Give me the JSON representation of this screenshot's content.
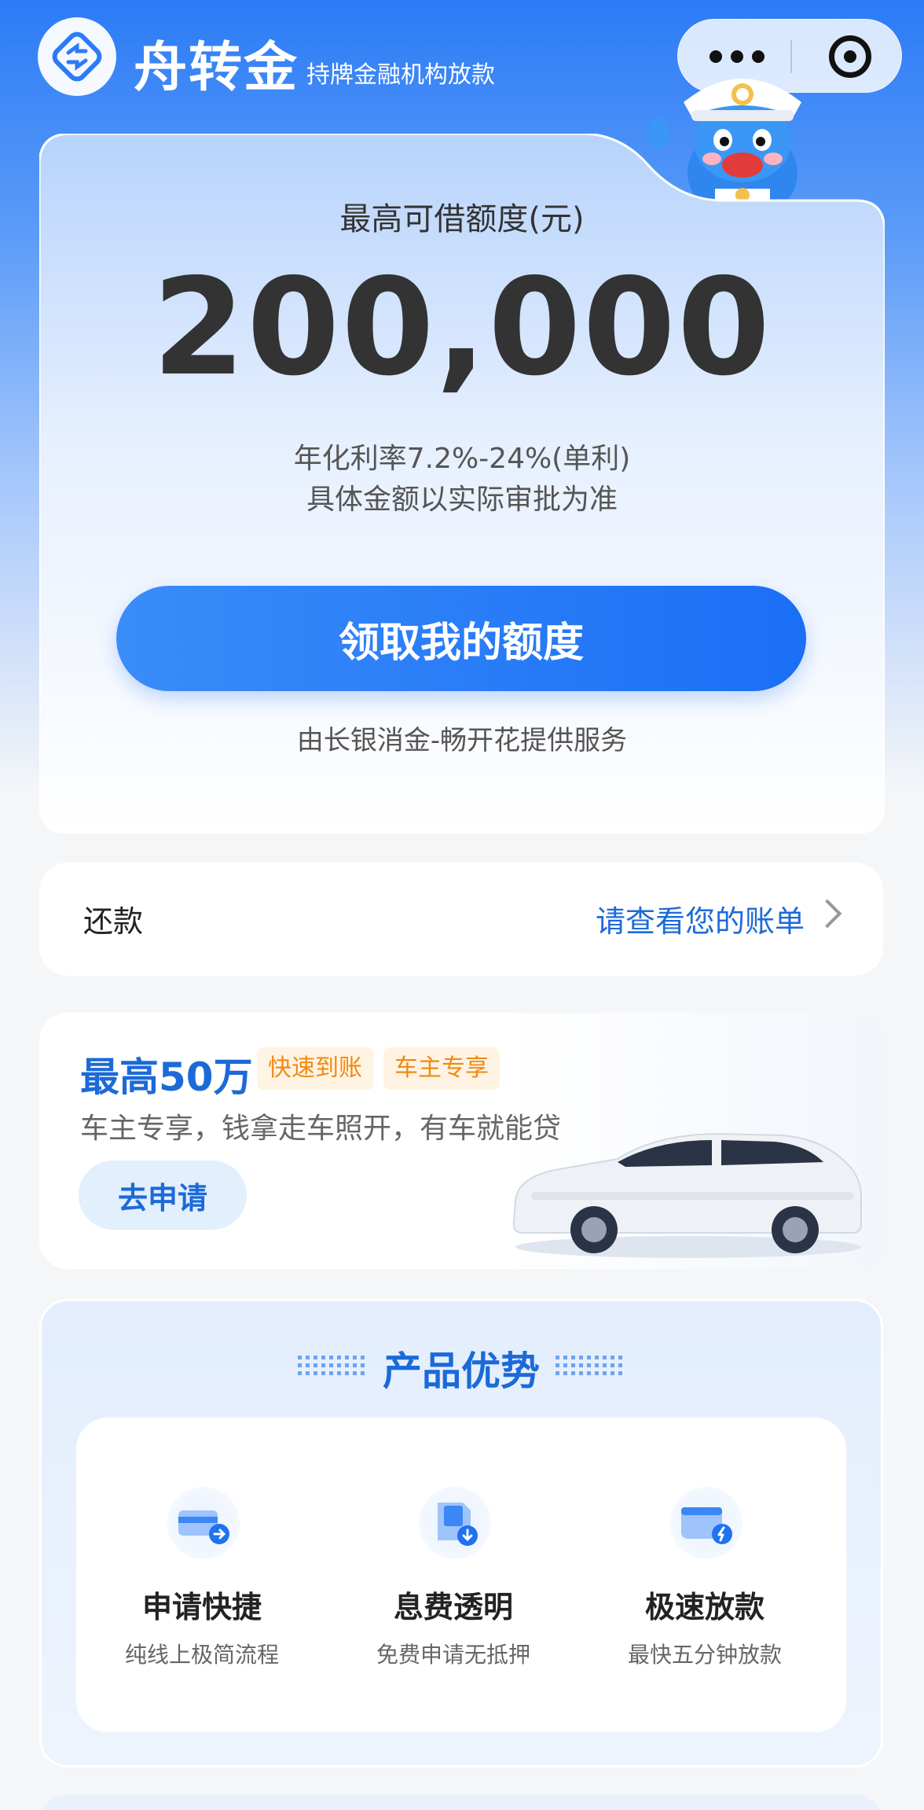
{
  "header": {
    "brand": "舟转金",
    "tagline": "持牌金融机构放款"
  },
  "quota": {
    "label": "最高可借额度(元)",
    "amount": "200,000",
    "rate": "年化利率7.2%-24%(单利)",
    "note": "具体金额以实际审批为准",
    "button": "领取我的额度",
    "provider": "由长银消金-畅开花提供服务"
  },
  "repay": {
    "label": "还款",
    "link": "请查看您的账单"
  },
  "promo": {
    "title": "最高50万",
    "badges": [
      "快速到账",
      "车主专享"
    ],
    "desc": "车主专享，钱拿走车照开，有车就能贷",
    "button": "去申请"
  },
  "advantages": {
    "title": "产品优势",
    "items": [
      {
        "icon": "card-arrow-icon",
        "title": "申请快捷",
        "sub": "纯线上极简流程"
      },
      {
        "icon": "document-download-icon",
        "title": "息费透明",
        "sub": "免费申请无抵押"
      },
      {
        "icon": "wallet-lightning-icon",
        "title": "极速放款",
        "sub": "最快五分钟放款"
      }
    ]
  },
  "colors": {
    "primary": "#1c6ad8",
    "button": "#1a6ff5",
    "badge_text": "#f08a12",
    "badge_bg": "#fff4e3"
  }
}
